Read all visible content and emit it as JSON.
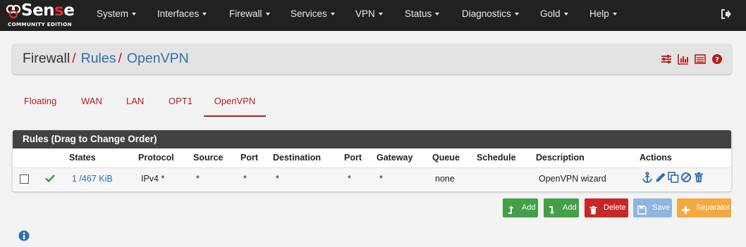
{
  "brand": {
    "logo_text_a": "Sen",
    "logo_text_b": "s",
    "logo_text_c": "e",
    "logo_sub": "COMMUNITY EDITION",
    "accent": "#d93026"
  },
  "nav": {
    "items": [
      {
        "label": "System"
      },
      {
        "label": "Interfaces"
      },
      {
        "label": "Firewall"
      },
      {
        "label": "Services"
      },
      {
        "label": "VPN"
      },
      {
        "label": "Status"
      },
      {
        "label": "Diagnostics"
      },
      {
        "label": "Gold"
      },
      {
        "label": "Help"
      }
    ],
    "logout_icon": "sign-out-icon"
  },
  "breadcrumb": {
    "root": "Firewall",
    "sep": "/",
    "level2": "Rules",
    "level3": "OpenVPN",
    "icons": [
      "sliders-icon",
      "bar-chart-icon",
      "list-icon",
      "question-circle-icon"
    ]
  },
  "tabs": [
    {
      "label": "Floating",
      "active": false
    },
    {
      "label": "WAN",
      "active": false
    },
    {
      "label": "LAN",
      "active": false
    },
    {
      "label": "OPT1",
      "active": false
    },
    {
      "label": "OpenVPN",
      "active": true
    }
  ],
  "rules": {
    "title": "Rules (Drag to Change Order)",
    "columns": [
      "States",
      "Protocol",
      "Source",
      "Port",
      "Destination",
      "Port",
      "Gateway",
      "Queue",
      "Schedule",
      "Description",
      "Actions"
    ],
    "rows": [
      {
        "states": "1 /467 KiB",
        "protocol": "IPv4 *",
        "source": "*",
        "source_port": "*",
        "destination": "*",
        "destination_port": "*",
        "gateway": "*",
        "queue": "none",
        "schedule": "",
        "description": "OpenVPN wizard",
        "enabled_icon": "check-icon",
        "actions": [
          "anchor-icon",
          "pencil-icon",
          "copy-icon",
          "ban-icon",
          "trash-icon"
        ]
      }
    ]
  },
  "buttons": {
    "add_top": "Add",
    "add_bottom": "Add",
    "delete": "Delete",
    "save": "Save",
    "separator": "Separator"
  },
  "colors": {
    "navbar": "#212121",
    "link": "#2e6fb0",
    "red": "#b71c1c",
    "green": "#43a047",
    "orange": "#f5a940"
  }
}
